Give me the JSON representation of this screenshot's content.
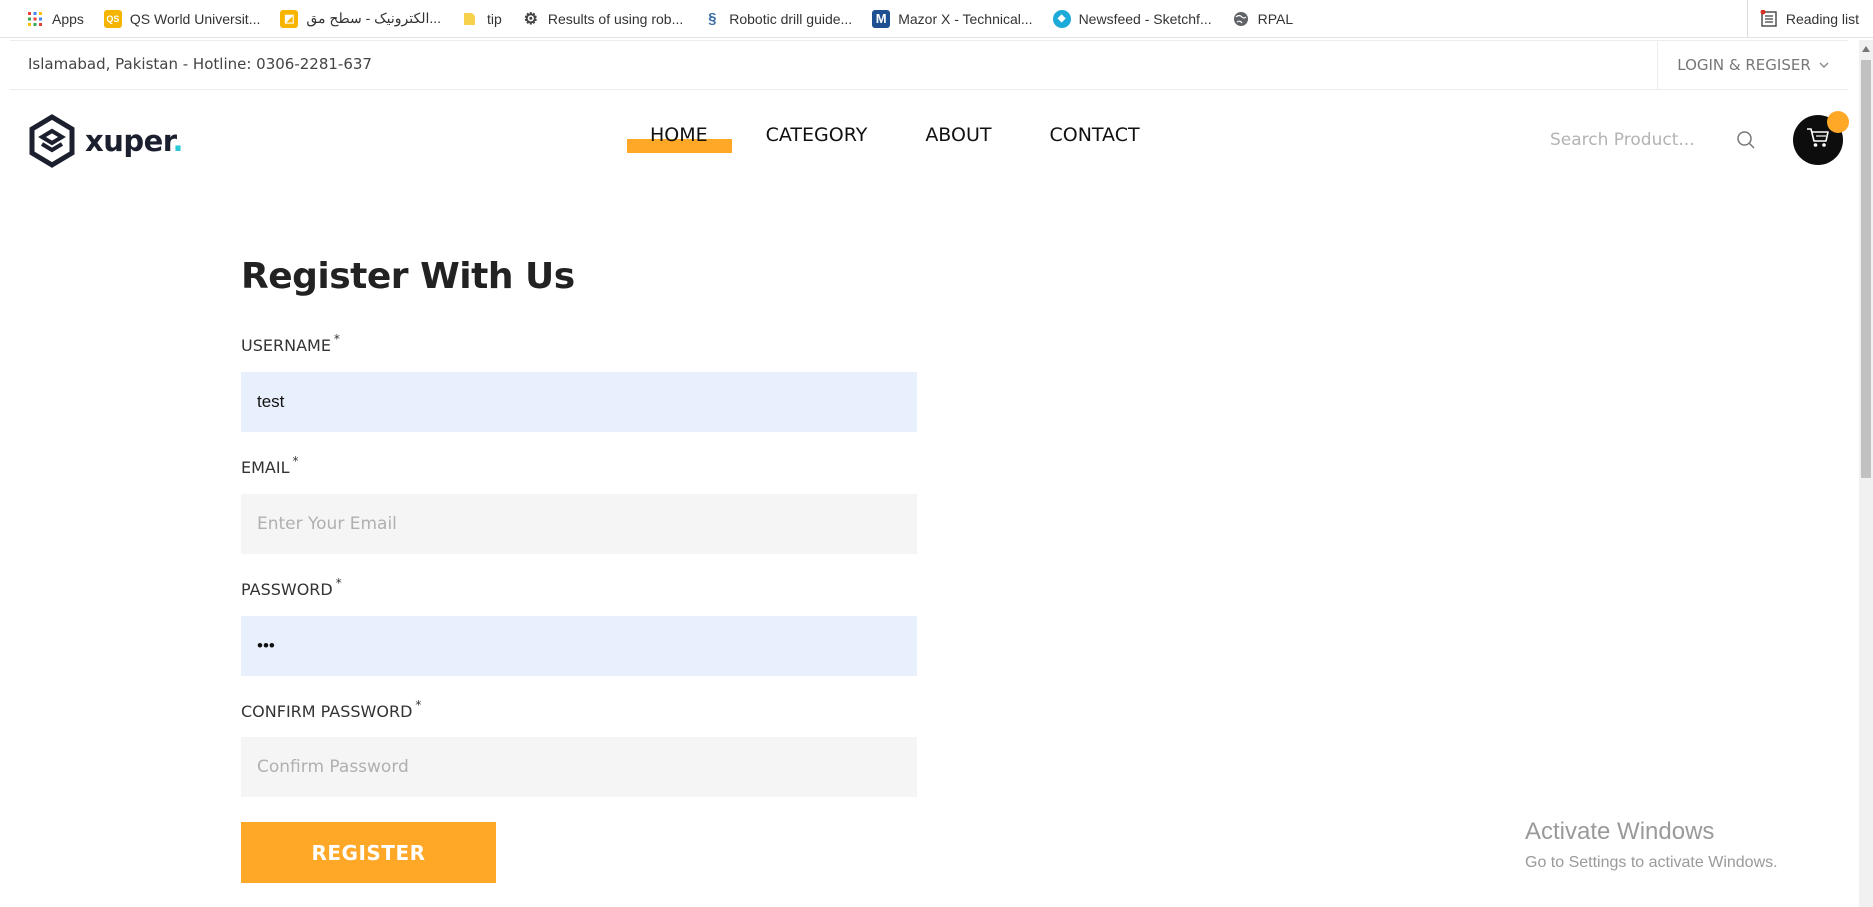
{
  "bookmarks": {
    "items": [
      {
        "label": "Apps",
        "icon": "apps-grid-icon"
      },
      {
        "label": "QS World Universit...",
        "icon": "qs-icon"
      },
      {
        "label": "الکترونیک - سطح مق...",
        "icon": "bookmark-yellow-icon"
      },
      {
        "label": "tip",
        "icon": "folder-icon"
      },
      {
        "label": "Results of using rob...",
        "icon": "gear-bug-icon"
      },
      {
        "label": "Robotic drill guide...",
        "icon": "helix-icon"
      },
      {
        "label": "Mazor X - Technical...",
        "icon": "m-logo-icon"
      },
      {
        "label": "Newsfeed - Sketchf...",
        "icon": "sketchfab-icon"
      },
      {
        "label": "RPAL",
        "icon": "globe-icon"
      }
    ],
    "reading_list": "Reading list"
  },
  "topbar": {
    "location": "Islamabad, Pakistan - Hotline: 0306-2281-637",
    "login": "LOGIN & REGISER"
  },
  "header": {
    "logo_text": "xuper",
    "logo_dot": ".",
    "nav": [
      {
        "label": "HOME",
        "active": true
      },
      {
        "label": "CATEGORY",
        "active": false
      },
      {
        "label": "ABOUT",
        "active": false
      },
      {
        "label": "CONTACT",
        "active": false
      }
    ],
    "search_placeholder": "Search Product..."
  },
  "form": {
    "title": "Register With Us",
    "username_label": "USERNAME",
    "username_value": "test",
    "email_label": "EMAIL",
    "email_placeholder": "Enter Your Email",
    "password_label": "PASSWORD",
    "password_value": "•••",
    "confirm_label": "CONFIRM PASSWORD",
    "confirm_placeholder": "Confirm Password",
    "required_mark": "*",
    "submit_label": "REGISTER"
  },
  "watermark": {
    "line1": "Activate Windows",
    "line2": "Go to Settings to activate Windows."
  },
  "colors": {
    "accent": "#ffa726",
    "autofill": "#e8f0fe",
    "input_bg": "#f5f5f5",
    "logo_dot": "#2bc8d6",
    "dark": "#1b1f2e"
  }
}
